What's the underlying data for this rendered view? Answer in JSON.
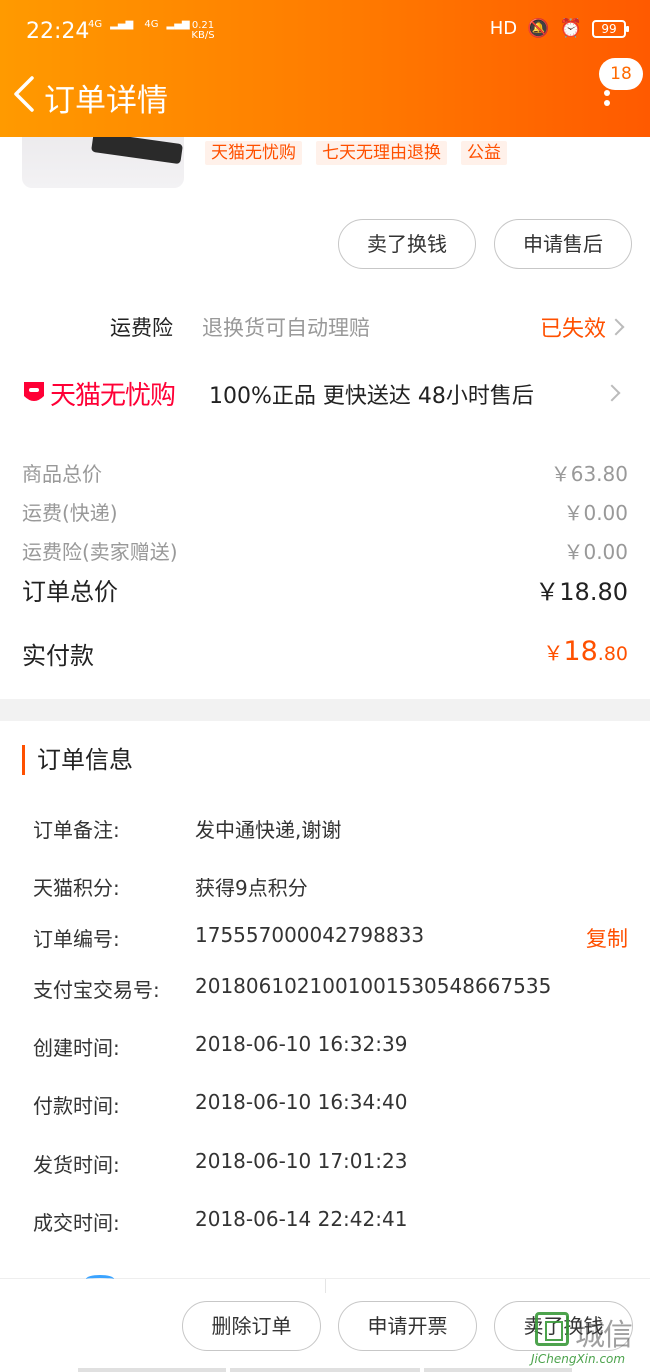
{
  "status_bar": {
    "time": "22:24",
    "net1": "4G",
    "net2": "4G",
    "speed_value": "0.21",
    "speed_unit": "KB/S",
    "hd": "HD",
    "battery": "99"
  },
  "nav": {
    "title": "订单详情",
    "badge": "18"
  },
  "product": {
    "tags": [
      "天猫无忧购",
      "七天无理由退换",
      "公益"
    ]
  },
  "item_actions": {
    "sell_label": "卖了换钱",
    "after_sale_label": "申请售后"
  },
  "freight_insurance": {
    "name": "运费险",
    "desc": "退换货可自动理赔",
    "status": "已失效"
  },
  "tmall_guarantee": {
    "brand": "天猫无忧购",
    "desc": "100%正品  更快送达  48小时售后"
  },
  "prices": {
    "goods_total_label": "商品总价",
    "goods_total_value": "￥63.80",
    "shipping_label": "运费(快递)",
    "shipping_value": "￥0.00",
    "insurance_label": "运费险(卖家赠送)",
    "insurance_value": "￥0.00",
    "order_total_label": "订单总价",
    "order_total_value": "￥18.80",
    "paid_label": "实付款",
    "paid_yen": "￥",
    "paid_int": "18",
    "paid_dec": ".80"
  },
  "order_info": {
    "title": "订单信息",
    "rows": [
      {
        "key": "订单备注:",
        "value": "发中通快递,谢谢"
      },
      {
        "key": "天猫积分:",
        "value": "获得9点积分"
      },
      {
        "key": "订单编号:",
        "value": "175557000042798833"
      },
      {
        "key": "支付宝交易号:",
        "value": "2018061021001001530548667535"
      },
      {
        "key": "创建时间:",
        "value": "2018-06-10 16:32:39"
      },
      {
        "key": "付款时间:",
        "value": "2018-06-10 16:34:40"
      },
      {
        "key": "发货时间:",
        "value": "2018-06-10 17:01:23"
      },
      {
        "key": "成交时间:",
        "value": "2018-06-14 22:42:41"
      }
    ],
    "copy_label": "复制"
  },
  "bottom_actions": {
    "delete_label": "删除订单",
    "invoice_label": "申请开票",
    "sell_label": "卖了换钱"
  },
  "watermark": {
    "text": "城信",
    "url": "JiChengXin.com"
  },
  "colors": {
    "header_start": "#ff9a00",
    "header_end": "#ff5a00",
    "accent": "#ff5000",
    "tmall_red": "#ff0036"
  }
}
